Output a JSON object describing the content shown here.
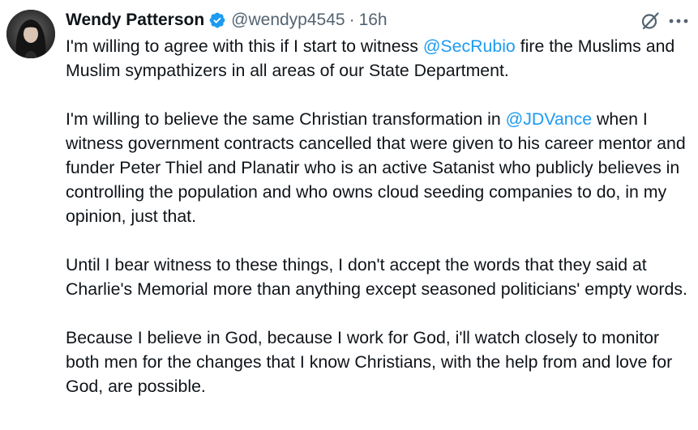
{
  "author": {
    "display_name": "Wendy Patterson",
    "handle": "@wendyp4545",
    "separator": "·",
    "timestamp": "16h",
    "verified_badge_color": "#1d9bf0"
  },
  "icons": {
    "grok": "grok-icon",
    "more": "more-icon",
    "verified": "verified-badge-icon"
  },
  "colors": {
    "mention": "#1d9bf0",
    "text": "#0f1419",
    "secondary": "#536471"
  },
  "tweet": {
    "p1": {
      "before": "I'm willing to agree with this if I start to witness ",
      "mention": "@SecRubio",
      "after": " fire the Muslims and Muslim sympathizers in all areas of our State Department."
    },
    "p2": {
      "before": "I'm willing to believe the same Christian transformation in ",
      "mention": "@JDVance",
      "after": " when I witness government contracts cancelled that were given to his career mentor and funder Peter Thiel and Planatir who is an active Satanist who publicly believes in controlling the population and who owns cloud seeding companies to do, in my opinion, just that."
    },
    "p3": "Until I bear witness to these things, I don't accept the words that they said at Charlie's Memorial more than anything except seasoned politicians' empty words.",
    "p4": "Because I believe in God, because I work for God, i'll watch closely to monitor both men for the changes that I know Christians, with the help from and love for God, are possible."
  }
}
